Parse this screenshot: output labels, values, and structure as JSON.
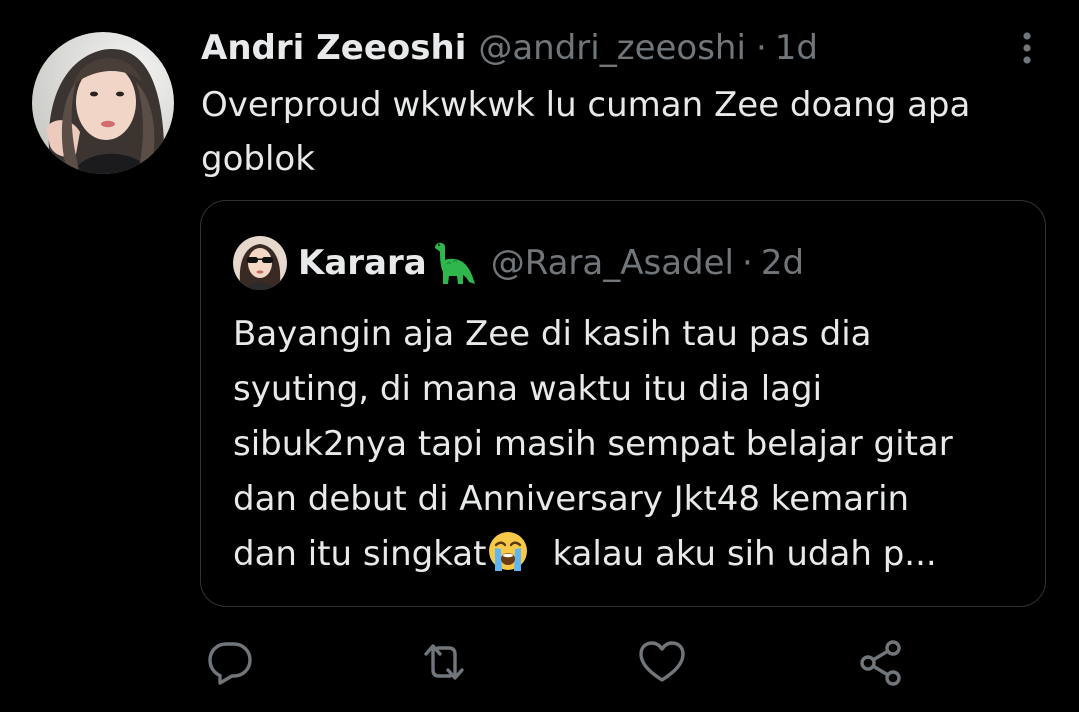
{
  "tweet": {
    "display_name": "Andri Zeeoshi",
    "handle": "@andri_zeeoshi",
    "separator": "·",
    "time": "1d",
    "text": "Overproud wkwkwk lu cuman Zee doang apa\ngoblok",
    "avatar_icon": "user-photo-avatar",
    "more_icon": "more-options-icon"
  },
  "quote": {
    "display_name": "Karara",
    "name_emoji": "sauropod-dinosaur-icon",
    "handle": "@Rara_Asadel",
    "separator": "·",
    "time": "2d",
    "lines": [
      "Bayangin aja Zee di kasih tau pas dia",
      "syuting, di mana waktu itu dia lagi",
      "sibuk2nya tapi masih sempat belajar gitar",
      "dan debut di Anniversary Jkt48 kemarin"
    ],
    "last_line_start": "dan itu singkat",
    "last_line_emoji": "loudly-crying-face-icon",
    "last_line_end": "kalau aku sih udah p..."
  },
  "actions": [
    {
      "name": "reply",
      "icon": "reply-icon"
    },
    {
      "name": "retweet",
      "icon": "retweet-icon"
    },
    {
      "name": "like",
      "icon": "like-heart-icon"
    },
    {
      "name": "share",
      "icon": "share-icon"
    }
  ],
  "colors": {
    "background": "#000000",
    "primary_text": "#e7e9ea",
    "secondary_text": "#71767b",
    "border": "#2f3336"
  }
}
